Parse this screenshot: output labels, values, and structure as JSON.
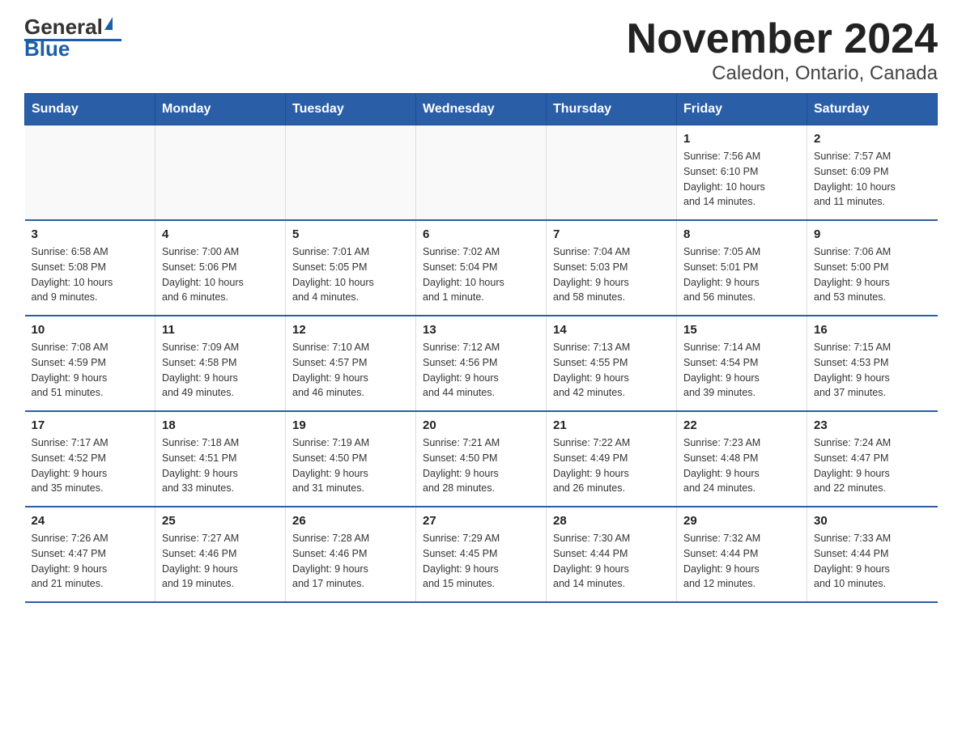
{
  "logo": {
    "general": "General",
    "blue": "Blue"
  },
  "title": "November 2024",
  "subtitle": "Caledon, Ontario, Canada",
  "days_of_week": [
    "Sunday",
    "Monday",
    "Tuesday",
    "Wednesday",
    "Thursday",
    "Friday",
    "Saturday"
  ],
  "weeks": [
    [
      {
        "day": "",
        "info": ""
      },
      {
        "day": "",
        "info": ""
      },
      {
        "day": "",
        "info": ""
      },
      {
        "day": "",
        "info": ""
      },
      {
        "day": "",
        "info": ""
      },
      {
        "day": "1",
        "info": "Sunrise: 7:56 AM\nSunset: 6:10 PM\nDaylight: 10 hours\nand 14 minutes."
      },
      {
        "day": "2",
        "info": "Sunrise: 7:57 AM\nSunset: 6:09 PM\nDaylight: 10 hours\nand 11 minutes."
      }
    ],
    [
      {
        "day": "3",
        "info": "Sunrise: 6:58 AM\nSunset: 5:08 PM\nDaylight: 10 hours\nand 9 minutes."
      },
      {
        "day": "4",
        "info": "Sunrise: 7:00 AM\nSunset: 5:06 PM\nDaylight: 10 hours\nand 6 minutes."
      },
      {
        "day": "5",
        "info": "Sunrise: 7:01 AM\nSunset: 5:05 PM\nDaylight: 10 hours\nand 4 minutes."
      },
      {
        "day": "6",
        "info": "Sunrise: 7:02 AM\nSunset: 5:04 PM\nDaylight: 10 hours\nand 1 minute."
      },
      {
        "day": "7",
        "info": "Sunrise: 7:04 AM\nSunset: 5:03 PM\nDaylight: 9 hours\nand 58 minutes."
      },
      {
        "day": "8",
        "info": "Sunrise: 7:05 AM\nSunset: 5:01 PM\nDaylight: 9 hours\nand 56 minutes."
      },
      {
        "day": "9",
        "info": "Sunrise: 7:06 AM\nSunset: 5:00 PM\nDaylight: 9 hours\nand 53 minutes."
      }
    ],
    [
      {
        "day": "10",
        "info": "Sunrise: 7:08 AM\nSunset: 4:59 PM\nDaylight: 9 hours\nand 51 minutes."
      },
      {
        "day": "11",
        "info": "Sunrise: 7:09 AM\nSunset: 4:58 PM\nDaylight: 9 hours\nand 49 minutes."
      },
      {
        "day": "12",
        "info": "Sunrise: 7:10 AM\nSunset: 4:57 PM\nDaylight: 9 hours\nand 46 minutes."
      },
      {
        "day": "13",
        "info": "Sunrise: 7:12 AM\nSunset: 4:56 PM\nDaylight: 9 hours\nand 44 minutes."
      },
      {
        "day": "14",
        "info": "Sunrise: 7:13 AM\nSunset: 4:55 PM\nDaylight: 9 hours\nand 42 minutes."
      },
      {
        "day": "15",
        "info": "Sunrise: 7:14 AM\nSunset: 4:54 PM\nDaylight: 9 hours\nand 39 minutes."
      },
      {
        "day": "16",
        "info": "Sunrise: 7:15 AM\nSunset: 4:53 PM\nDaylight: 9 hours\nand 37 minutes."
      }
    ],
    [
      {
        "day": "17",
        "info": "Sunrise: 7:17 AM\nSunset: 4:52 PM\nDaylight: 9 hours\nand 35 minutes."
      },
      {
        "day": "18",
        "info": "Sunrise: 7:18 AM\nSunset: 4:51 PM\nDaylight: 9 hours\nand 33 minutes."
      },
      {
        "day": "19",
        "info": "Sunrise: 7:19 AM\nSunset: 4:50 PM\nDaylight: 9 hours\nand 31 minutes."
      },
      {
        "day": "20",
        "info": "Sunrise: 7:21 AM\nSunset: 4:50 PM\nDaylight: 9 hours\nand 28 minutes."
      },
      {
        "day": "21",
        "info": "Sunrise: 7:22 AM\nSunset: 4:49 PM\nDaylight: 9 hours\nand 26 minutes."
      },
      {
        "day": "22",
        "info": "Sunrise: 7:23 AM\nSunset: 4:48 PM\nDaylight: 9 hours\nand 24 minutes."
      },
      {
        "day": "23",
        "info": "Sunrise: 7:24 AM\nSunset: 4:47 PM\nDaylight: 9 hours\nand 22 minutes."
      }
    ],
    [
      {
        "day": "24",
        "info": "Sunrise: 7:26 AM\nSunset: 4:47 PM\nDaylight: 9 hours\nand 21 minutes."
      },
      {
        "day": "25",
        "info": "Sunrise: 7:27 AM\nSunset: 4:46 PM\nDaylight: 9 hours\nand 19 minutes."
      },
      {
        "day": "26",
        "info": "Sunrise: 7:28 AM\nSunset: 4:46 PM\nDaylight: 9 hours\nand 17 minutes."
      },
      {
        "day": "27",
        "info": "Sunrise: 7:29 AM\nSunset: 4:45 PM\nDaylight: 9 hours\nand 15 minutes."
      },
      {
        "day": "28",
        "info": "Sunrise: 7:30 AM\nSunset: 4:44 PM\nDaylight: 9 hours\nand 14 minutes."
      },
      {
        "day": "29",
        "info": "Sunrise: 7:32 AM\nSunset: 4:44 PM\nDaylight: 9 hours\nand 12 minutes."
      },
      {
        "day": "30",
        "info": "Sunrise: 7:33 AM\nSunset: 4:44 PM\nDaylight: 9 hours\nand 10 minutes."
      }
    ]
  ]
}
